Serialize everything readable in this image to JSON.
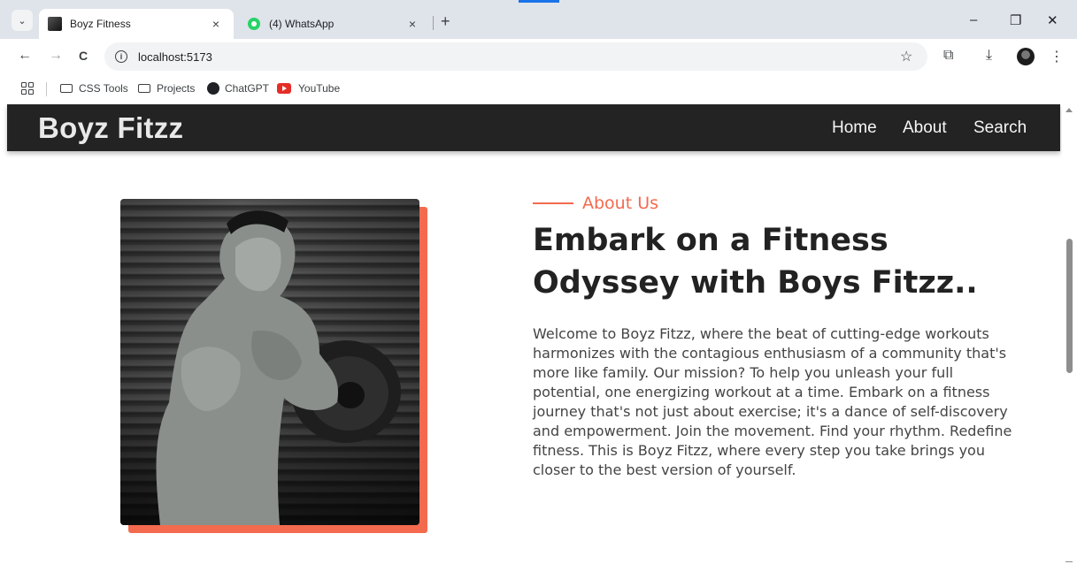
{
  "browser": {
    "tabs": [
      {
        "title": "Boyz Fitness",
        "close": "×",
        "active": true
      },
      {
        "title": "(4) WhatsApp",
        "close": "×",
        "active": false
      }
    ],
    "new_tab": "+",
    "window_controls": {
      "minimize": "–",
      "restore": "❐",
      "close": "✕"
    },
    "nav": {
      "back": "←",
      "forward": "→",
      "reload": "C"
    },
    "address": "localhost:5173",
    "toolbar_icons": {
      "star": "☆",
      "extensions": "⧉",
      "download": "⤓",
      "menu": "⋮"
    },
    "bookmarks": [
      {
        "label": "CSS Tools",
        "icon": "folder-icon"
      },
      {
        "label": "Projects",
        "icon": "folder-icon"
      },
      {
        "label": "ChatGPT",
        "icon": "chatgpt-icon"
      },
      {
        "label": "YouTube",
        "icon": "youtube-icon"
      }
    ]
  },
  "site": {
    "brand": "Boyz Fitzz",
    "nav": [
      "Home",
      "About",
      "Search"
    ]
  },
  "about": {
    "eyebrow": "About Us",
    "headline": "Embark on a Fitness Odyssey with Boys Fitzz..",
    "body": "Welcome to Boyz Fitzz, where the beat of cutting-edge workouts harmonizes with the contagious enthusiasm of a community that's more like family. Our mission? To help you unleash your full potential, one energizing workout at a time. Embark on a fitness journey that's not just about exercise; it's a dance of self-discovery and empowerment. Join the movement. Find your rhythm. Redefine fitness. This is Boyz Fitzz, where every step you take brings you closer to the best version of yourself."
  },
  "colors": {
    "accent": "#f46a4e",
    "nav_bg": "#232323",
    "heading": "#222222",
    "body": "#444444"
  }
}
